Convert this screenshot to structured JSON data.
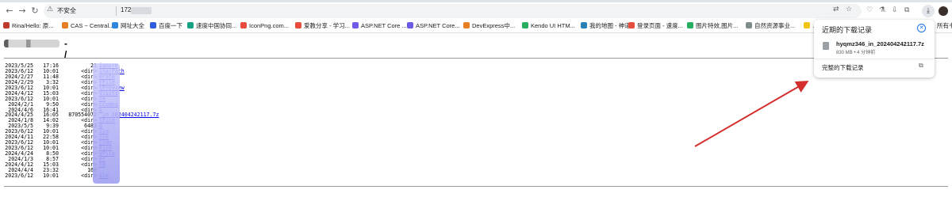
{
  "browser": {
    "nav": {
      "back": "←",
      "forward": "→",
      "reload": "↻"
    },
    "omnibox": {
      "security_icon": "warning-triangle-icon",
      "security_glyph": "⚠",
      "security_label": "不安全",
      "url": "172.",
      "translate_glyph": "⇄",
      "bookmark_glyph": "☆"
    },
    "toolbar_icons": [
      "shield-icon",
      "flask-icon",
      "pin-icon",
      "puzzle-icon"
    ],
    "toolbar_glyphs": [
      "♡",
      "⚗",
      "⇩",
      "⧉"
    ],
    "downloads_glyph": "⤓"
  },
  "bookmarks": [
    {
      "label": "Rina/Hello: 原...",
      "color": "#c0392b"
    },
    {
      "label": "CAS ~ Central...",
      "color": "#e67e22"
    },
    {
      "label": "网址大全",
      "color": "#2e86de"
    },
    {
      "label": "百度一下",
      "color": "#2e5cdd"
    },
    {
      "label": "速度中国协同...",
      "color": "#16a085"
    },
    {
      "label": "IconPng.com...",
      "color": "#e74c3c"
    },
    {
      "label": "爱教分享 - 学习...",
      "color": "#e74c3c"
    },
    {
      "label": "ASP.NET Core ...",
      "color": "#6c5ce7"
    },
    {
      "label": "ASP.NET Core...",
      "color": "#6c5ce7"
    },
    {
      "label": "DevExpress中...",
      "color": "#e67e22"
    },
    {
      "label": "Kendo UI HTM...",
      "color": "#27ae60"
    },
    {
      "label": "我的地图 - 神道",
      "color": "#2980b9"
    },
    {
      "label": "登录页面 - 速度...",
      "color": "#e74c3c"
    },
    {
      "label": "图片特效,图片...",
      "color": "#27ae60"
    },
    {
      "label": "自然资源事业...",
      "color": "#7f8c8d"
    },
    {
      "label": "…",
      "color": "#f1c40f"
    }
  ],
  "more_bookmarks": "所有书",
  "page": {
    "heading_suffix": "- /",
    "listing": [
      {
        "date": "2023/5/25",
        "time": "17:16",
        "size": "21",
        "name": "ignore"
      },
      {
        "date": "2023/6/12",
        "time": "10:01",
        "size": "<dir>",
        "name": "inalPath"
      },
      {
        "date": "2024/2/27",
        "time": "11:48",
        "size": "<dir>",
        "name": "erate"
      },
      {
        "date": "2024/2/29",
        "time": "3:32",
        "size": "<dir>",
        "name": "tFile"
      },
      {
        "date": "2023/6/12",
        "time": "10:01",
        "size": "<dir>",
        "name": "tPreview"
      },
      {
        "date": "2024/4/12",
        "time": "15:03",
        "size": "<dir>",
        "name": "Visits"
      },
      {
        "date": "2023/6/12",
        "time": "10:01",
        "size": "<dir>",
        "name": "le"
      },
      {
        "date": "2024/2/1",
        "time": "9:50",
        "size": "<dir>",
        "name": "ccodes"
      },
      {
        "date": "2024/4/6",
        "time": "16:41",
        "size": "<dir>",
        "name": "s"
      },
      {
        "date": "2024/4/25",
        "time": "16:05",
        "size": "870554072",
        "name": "_in_202404242117.7z"
      },
      {
        "date": "2024/1/8",
        "time": "14:02",
        "size": "<dir>",
        "name": "tFile"
      },
      {
        "date": "2023/5/5",
        "time": "9:39",
        "size": "6483",
        "name": "d"
      },
      {
        "date": "2023/6/12",
        "time": "10:01",
        "size": "<dir>",
        "name": "ile"
      },
      {
        "date": "2024/4/11",
        "time": "22:58",
        "size": "<dir>",
        "name": "ile"
      },
      {
        "date": "2023/6/12",
        "time": "10:01",
        "size": "<dir>",
        "name": "Code"
      },
      {
        "date": "2023/6/12",
        "time": "10:01",
        "size": "<dir>",
        "name": "File"
      },
      {
        "date": "2024/4/24",
        "time": "8:50",
        "size": "<dir>",
        "name": "yFile"
      },
      {
        "date": "2024/1/3",
        "time": "8:57",
        "size": "<dir>",
        "name": "er"
      },
      {
        "date": "2024/4/12",
        "time": "15:03",
        "size": "<dir>",
        "name": "rd"
      },
      {
        "date": "2024/4/4",
        "time": "23:32",
        "size": "160",
        "name": ""
      },
      {
        "date": "2023/6/12",
        "time": "10:01",
        "size": "<dir>",
        "name": "ile"
      }
    ]
  },
  "downloads_panel": {
    "title": "近期的下载记录",
    "close_glyph": "✕",
    "file_name": "hyqmz346_in_202404242117.7z",
    "file_meta": "830 MB • 4 分钟前",
    "full_history": "完整的下载记录",
    "open_glyph": "⧉"
  },
  "colors": {
    "arrow": "#d32f2f",
    "link": "#0000ee",
    "accent": "#1a73e8"
  }
}
